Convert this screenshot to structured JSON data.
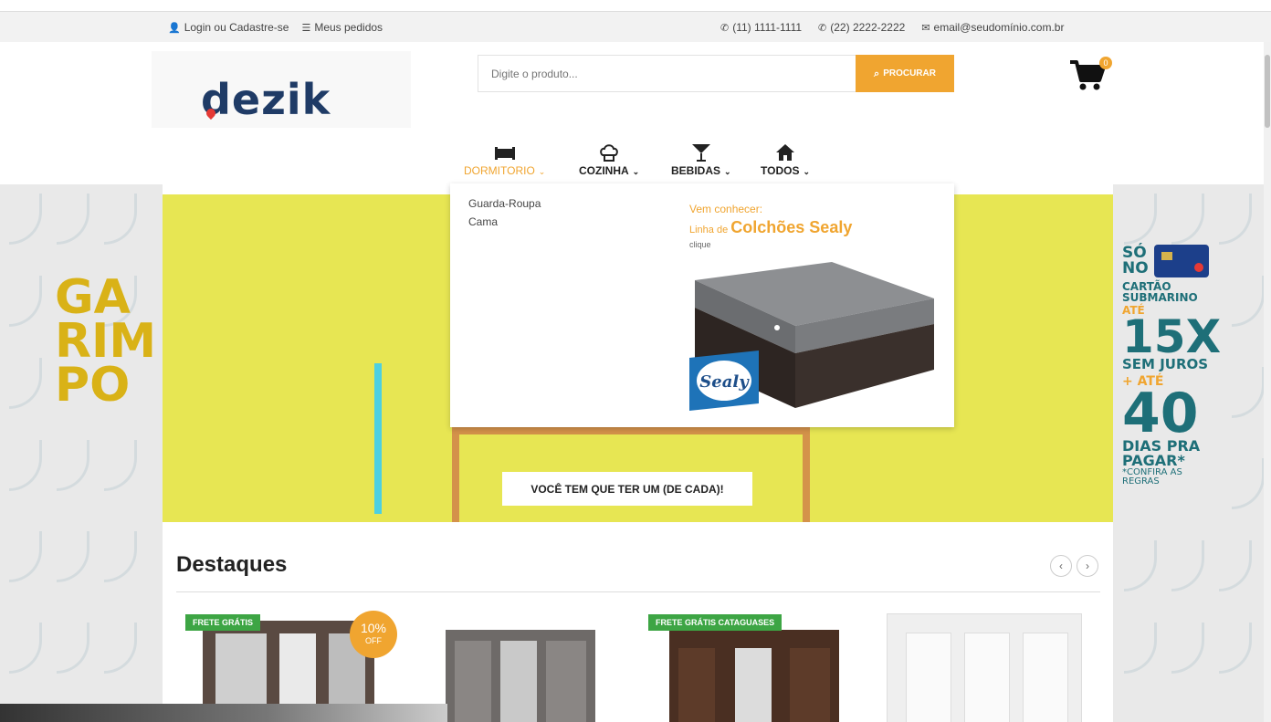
{
  "topbar": {
    "login": "Login ou Cadastre-se",
    "orders": "Meus pedidos",
    "phone1": "(11) 1111-1111",
    "phone2": "(22) 2222-2222",
    "email": "email@seudomínio.com.br"
  },
  "header": {
    "logo": "dezik",
    "search_placeholder": "Digite o produto...",
    "search_button": "PROCURAR",
    "cart_count": "0"
  },
  "nav": {
    "items": [
      {
        "label": "DORMITORIO",
        "icon": "bed-icon"
      },
      {
        "label": "COZINHA",
        "icon": "chef-hat-icon"
      },
      {
        "label": "BEBIDAS",
        "icon": "cocktail-icon"
      },
      {
        "label": "TODOS",
        "icon": "home-icon"
      }
    ]
  },
  "dropdown": {
    "links": [
      "Guarda-Roupa",
      "Cama"
    ],
    "promo_line1": "Vem conhecer:",
    "promo_line2_prefix": "Linha de",
    "promo_line2_brand": "Colchões Sealy",
    "promo_line3": "clique",
    "sealy_logo": "Sealy"
  },
  "banner": {
    "garimpo": [
      "GA",
      "RIM",
      "PO"
    ],
    "tagline": "VOCÊ TEM QUE TER UM (DE CADA)!",
    "promo": [
      "SÓ",
      "NO",
      "CARTÃO",
      "SUBMARINO",
      "ATÉ",
      "15X",
      "SEM JUROS",
      "+ ATÉ",
      "40",
      "DIAS PRA",
      "PAGAR*",
      "*CONFIRA AS",
      "REGRAS"
    ]
  },
  "destaques": {
    "title": "Destaques",
    "badge1": "FRETE GRÁTIS",
    "badge2": "FRETE GRÁTIS CATAGUASES",
    "discount_pct": "10%",
    "discount_label": "OFF"
  },
  "colors": {
    "accent": "#f0a530",
    "banner_yellow": "#e7e653",
    "navy": "#1f3b66",
    "green": "#3da544"
  }
}
